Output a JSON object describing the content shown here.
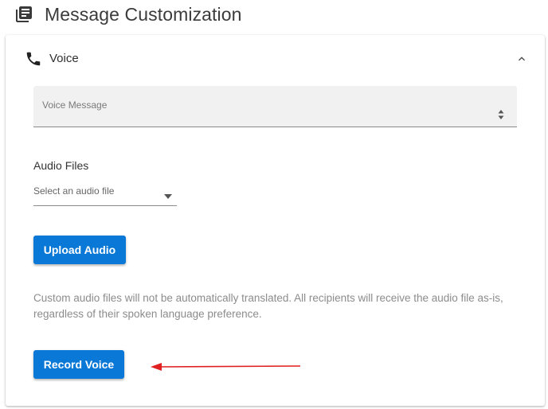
{
  "header": {
    "title": "Message Customization",
    "icon": "library-books-icon"
  },
  "voice_section": {
    "title": "Voice",
    "icon": "phone-icon",
    "collapse_icon": "chevron-up-icon",
    "expanded": true,
    "voice_message": {
      "label": "Voice Message",
      "value": ""
    },
    "audio_files": {
      "label": "Audio Files",
      "placeholder": "Select an audio file"
    },
    "upload_button": "Upload Audio",
    "helper_text": "Custom audio files will not be automatically translated. All recipients will receive the audio file as-is, regardless of their spoken language preference.",
    "record_button": "Record Voice"
  },
  "colors": {
    "primary_button": "#0a78d6",
    "annotation_arrow": "#e02020"
  }
}
